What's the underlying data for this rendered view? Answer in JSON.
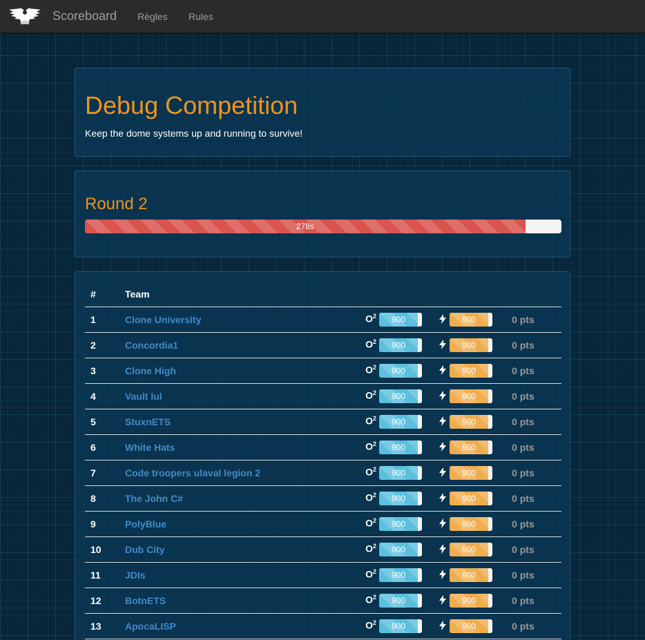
{
  "nav": {
    "brand": "Scoreboard",
    "links": [
      "Règles",
      "Rules"
    ]
  },
  "competition": {
    "title": "Debug Competition",
    "subtitle": "Keep the dome systems up and running to survive!"
  },
  "round": {
    "title": "Round 2",
    "timer_label": "278s",
    "progress_fraction": 0.924
  },
  "table": {
    "headers": {
      "rank": "#",
      "team": "Team"
    },
    "o2_label": "O",
    "o2_sup": "2",
    "o2_max": 1000,
    "power_max": 1000
  },
  "colors": {
    "accent": "#f0931d",
    "link": "#428bca",
    "o2_bar": "#5bc0de",
    "power_bar": "#f0ad4e",
    "round_bar": "#d9534f"
  },
  "teams": [
    {
      "rank": "1",
      "name": "Clone University",
      "o2": "900",
      "power": "900",
      "points": "0 pts"
    },
    {
      "rank": "2",
      "name": "Concordia1",
      "o2": "900",
      "power": "900",
      "points": "0 pts"
    },
    {
      "rank": "3",
      "name": "Clone High",
      "o2": "900",
      "power": "900",
      "points": "0 pts"
    },
    {
      "rank": "4",
      "name": "Vault lul",
      "o2": "900",
      "power": "900",
      "points": "0 pts"
    },
    {
      "rank": "5",
      "name": "StuxnETS",
      "o2": "900",
      "power": "900",
      "points": "0 pts"
    },
    {
      "rank": "6",
      "name": "White Hats",
      "o2": "900",
      "power": "900",
      "points": "0 pts"
    },
    {
      "rank": "7",
      "name": "Code troopers ulaval legion 2",
      "o2": "900",
      "power": "900",
      "points": "0 pts"
    },
    {
      "rank": "8",
      "name": "The John C#",
      "o2": "900",
      "power": "900",
      "points": "0 pts"
    },
    {
      "rank": "9",
      "name": "PolyBlue",
      "o2": "900",
      "power": "900",
      "points": "0 pts"
    },
    {
      "rank": "10",
      "name": "Dub City",
      "o2": "900",
      "power": "900",
      "points": "0 pts"
    },
    {
      "rank": "11",
      "name": "JDIs",
      "o2": "900",
      "power": "900",
      "points": "0 pts"
    },
    {
      "rank": "12",
      "name": "BotnETS",
      "o2": "900",
      "power": "900",
      "points": "0 pts"
    },
    {
      "rank": "13",
      "name": "ApocaLISP",
      "o2": "900",
      "power": "900",
      "points": "0 pts"
    }
  ]
}
